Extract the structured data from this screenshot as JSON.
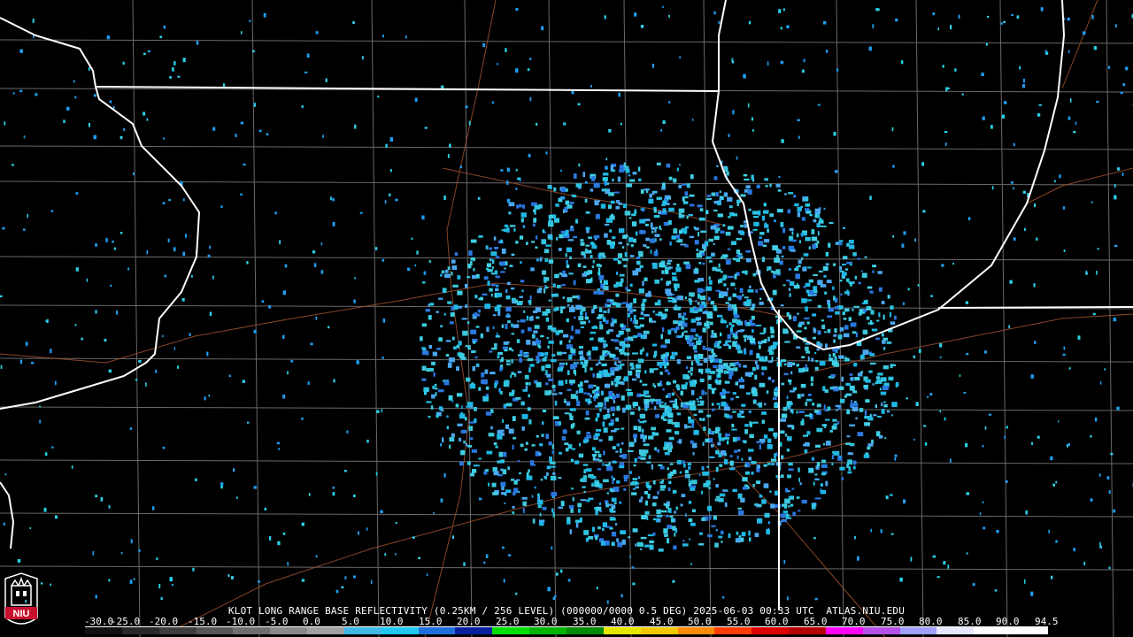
{
  "product": {
    "caption": "KLOT LONG RANGE BASE REFLECTIVITY (0.25KM / 256 LEVEL) (000000/0000 0.5 DEG) 2025-06-03 00:33 UTC  ATLAS.NIU.EDU"
  },
  "logo": {
    "text": "NIU",
    "color": "#c8102e"
  },
  "colorscale": {
    "labels": [
      "-30.0",
      "-25.0",
      "-20.0",
      "-15.0",
      "-10.0",
      "-5.0",
      "0.0",
      "5.0",
      "10.0",
      "15.0",
      "20.0",
      "25.0",
      "30.0",
      "35.0",
      "40.0",
      "45.0",
      "50.0",
      "55.0",
      "60.0",
      "65.0",
      "70.0",
      "75.0",
      "80.0",
      "85.0",
      "90.0",
      "94.5"
    ],
    "colors": [
      "#101010",
      "#282828",
      "#3c3c3c",
      "#555555",
      "#6e6e6e",
      "#8a8a8a",
      "#a0a0a0",
      "#3fb8e6",
      "#1ec8f0",
      "#1e6edc",
      "#0a1ea0",
      "#00e000",
      "#00b400",
      "#008c00",
      "#e6e600",
      "#f0c800",
      "#ff8c00",
      "#ff3c00",
      "#e00000",
      "#b40000",
      "#ff00ff",
      "#b450e6",
      "#a0a0ff",
      "#e6e6ff",
      "#ffffff",
      "#ffffff"
    ]
  }
}
